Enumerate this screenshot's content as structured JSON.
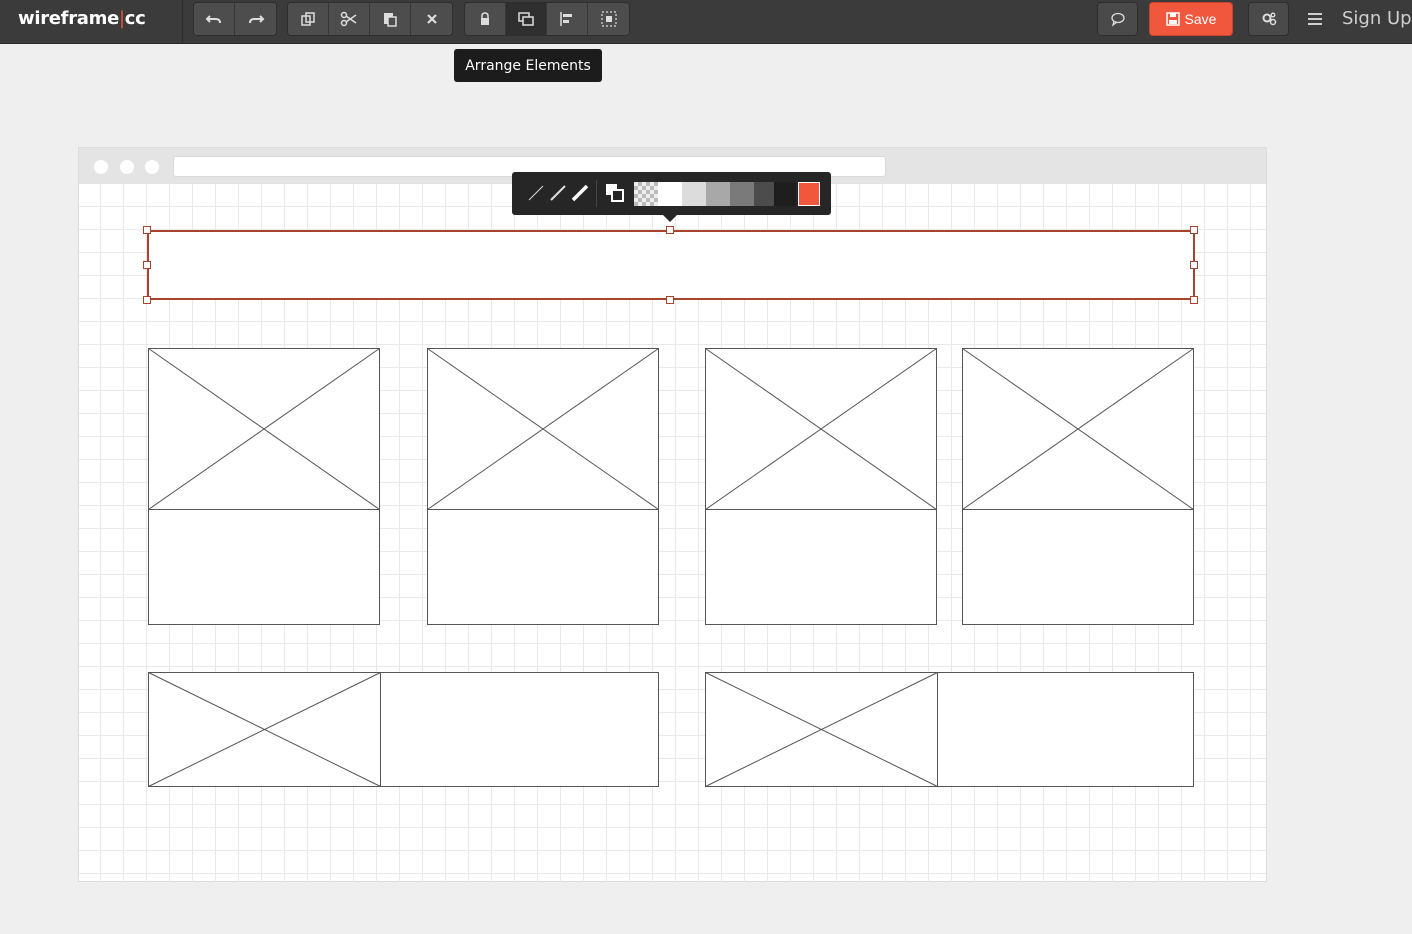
{
  "app": {
    "logo_main": "wireframe",
    "logo_pipe": "|",
    "logo_suffix": "cc"
  },
  "toolbar": {
    "history": [
      "undo-icon",
      "redo-icon"
    ],
    "edit": [
      "duplicate-icon",
      "cut-icon",
      "paste-icon",
      "delete-icon"
    ],
    "arrange": [
      "lock-icon",
      "arrange-icon",
      "align-icon",
      "group-icon"
    ],
    "active_tool": "arrange-icon",
    "comment_icon": "comment-icon",
    "save_label": "Save",
    "settings_icon": "settings-icon",
    "menu_icon": "menu-icon",
    "signup_label": "Sign Up"
  },
  "tooltip": {
    "text": "Arrange Elements"
  },
  "style_toolbar": {
    "line_styles": [
      "thin-line-icon",
      "medium-line-icon",
      "thick-line-icon"
    ],
    "layer_icon": "bring-forward-icon",
    "swatches": [
      "#transparent",
      "#ffffff",
      "#dcdcdc",
      "#a8a8a8",
      "#7a7a7a",
      "#4c4c4c",
      "#1e1e1e",
      "#f0573c"
    ],
    "active_swatch": "#f0573c"
  },
  "colors": {
    "accent": "#f0573c",
    "selection": "#a8442e",
    "topbar": "#3b3b3b"
  },
  "wireframe": {
    "top_cards": 4,
    "bottom_cards": 2
  }
}
